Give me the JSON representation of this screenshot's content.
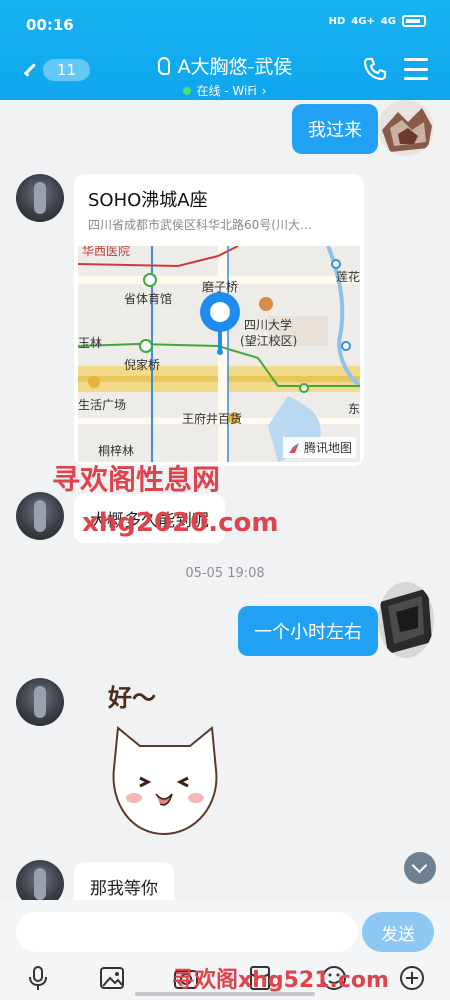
{
  "status_bar": {
    "time": "00:16",
    "signal1": "4G+",
    "signal2": "4G",
    "hd": "HD"
  },
  "header": {
    "unread_count": "11",
    "title": "A大胸悠-武侯",
    "online_status": "在线 - WiFi",
    "online_chevron": "›",
    "icons": [
      "back-chevron-icon",
      "ear-icon",
      "phone-icon",
      "menu-icon"
    ]
  },
  "messages": {
    "msg1_text": "我过来",
    "location": {
      "name": "SOHO沸城A座",
      "address": "四川省成都市武侯区科华北路60号(川大…",
      "map_labels": {
        "hospital": "华西医院",
        "lotus": "莲花",
        "sports": "省体育馆",
        "mozi": "磨子桥",
        "university": "四川大学",
        "campus": "(望江校区)",
        "yulin": "玉林",
        "nijia": "倪家桥",
        "plaza": "生活广场",
        "wangfujing": "王府井百货",
        "east": "东",
        "tongzi": "桐梓林"
      },
      "brand": "腾讯地图"
    },
    "msg3_text": "大概多久能到呢",
    "timestamp": "05-05 19:08",
    "msg4_text": "一个小时左右",
    "sticker_text": "好～",
    "msg6_text": "那我等你"
  },
  "watermarks": {
    "wm1": "寻欢阁性息网",
    "wm2": "xhg2020.com",
    "wm3": "寻欢阁xhg521.com"
  },
  "input": {
    "placeholder": "",
    "send_label": "发送"
  },
  "toolbar": {
    "icons": [
      "mic-icon",
      "image-icon",
      "camera-icon",
      "red-packet-icon",
      "emoji-icon",
      "plus-icon"
    ]
  },
  "colors": {
    "header": "#12aaee",
    "bubble_right": "#21a1f3",
    "send": "#8cc8f3",
    "watermark": "#e0434c"
  }
}
